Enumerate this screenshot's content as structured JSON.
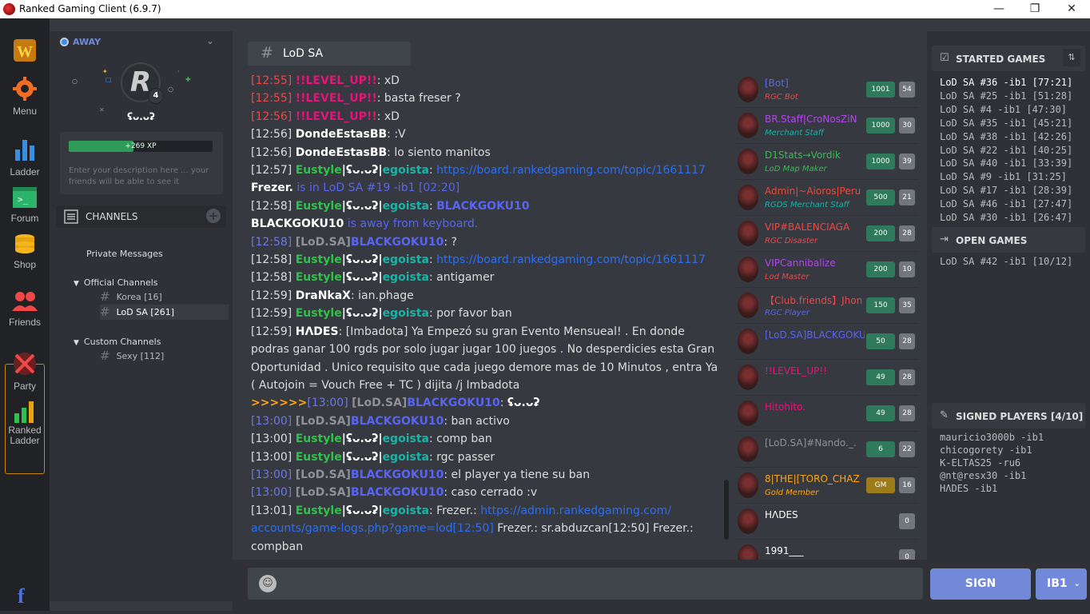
{
  "window": {
    "title": "Ranked Gaming Client (6.9.7)",
    "min": "—",
    "max": "❐",
    "close": "✕"
  },
  "nav": {
    "menu": "Menu",
    "ladder": "Ladder",
    "forum": "Forum",
    "shop": "Shop",
    "friends": "Friends",
    "party": "Party",
    "ranked_ladder_1": "Ranked",
    "ranked_ladder_2": "Ladder"
  },
  "profile": {
    "status": "AWAY",
    "username": "ʢᴗ.ᴗʡ",
    "level": "4",
    "avatar_letter": "R",
    "xp": "+269 XP",
    "xp_progress": 0.45,
    "description": "Enter your description here ... your friends will be able to see it"
  },
  "channels": {
    "header": "CHANNELS",
    "private": "Private Messages",
    "official": "Official Channels",
    "official_list": [
      "Korea [16]",
      "LoD SA [261]"
    ],
    "custom": "Custom Channels",
    "custom_list": [
      "Sexy [112]"
    ]
  },
  "chat": {
    "tab": "LoD SA",
    "hash": "#",
    "messages": [
      {
        "ts": "[12:55]",
        "tsc": "ts-r",
        "name": "!!LEVEL_UP!!",
        "nc": "lvl-r",
        "text": ": xD"
      },
      {
        "ts": "[12:55]",
        "tsc": "ts-r",
        "name": "!!LEVEL_UP!!",
        "nc": "lvl-r",
        "text": ": basta freser ?"
      },
      {
        "ts": "[12:56]",
        "tsc": "ts-r",
        "name": "!!LEVEL_UP!!",
        "nc": "lvl-r",
        "text": ": xD"
      },
      {
        "ts": "[12:56]",
        "name": "DondeEstasBB",
        "nc": "wh",
        "text": ": :V"
      },
      {
        "ts": "[12:56]",
        "name": "DondeEstasBB",
        "nc": "wh",
        "text": ": lo siento manitos"
      },
      {
        "ts": "[12:57]",
        "name": "Eustyle",
        "nc": "grn",
        "sep": "|",
        "name2": "ʢᴗ.ᴗʡ",
        "n2c": "wh",
        "sep2": "|",
        "name3": "egoista",
        "n3c": "teal",
        "text": ": ",
        "link": "https://board.rankedgaming.com/topic/1661117"
      },
      {
        "ts": "",
        "name": "Frezer.",
        "nc": "wh",
        "text2": " is in LoD SA #19 -ib1 [02:20]"
      },
      {
        "ts": "[12:58]",
        "name": "Eustyle",
        "nc": "grn",
        "sep": "|",
        "name2": "ʢᴗ.ᴗʡ",
        "n2c": "wh",
        "sep2": "|",
        "name3": "egoista",
        "n3c": "teal",
        "text": ": ",
        "text3": "BLACKGOKU10"
      },
      {
        "ts": "",
        "name": "BLACKGOKU10",
        "nc": "wh",
        "text2": " is away from keyboard."
      },
      {
        "ts": "[12:58]",
        "tsc": "bl-ts",
        "pre": "[LoD.SA]",
        "name": "BLACKGOKU10",
        "nc": "bk",
        "text": ": ?"
      },
      {
        "ts": "[12:58]",
        "name": "Eustyle",
        "nc": "grn",
        "sep": "|",
        "name2": "ʢᴗ.ᴗʡ",
        "n2c": "wh",
        "sep2": "|",
        "name3": "egoista",
        "n3c": "teal",
        "text": ": ",
        "link": "https://board.rankedgaming.com/topic/1661117"
      },
      {
        "ts": "[12:58]",
        "name": "Eustyle",
        "nc": "grn",
        "sep": "|",
        "name2": "ʢᴗ.ᴗʡ",
        "n2c": "wh",
        "sep2": "|",
        "name3": "egoista",
        "n3c": "teal",
        "text": ": antigamer"
      },
      {
        "ts": "[12:59]",
        "name": "DraNkaX",
        "nc": "wh",
        "text": ": ian.phage"
      },
      {
        "ts": "[12:59]",
        "name": "Eustyle",
        "nc": "grn",
        "sep": "|",
        "name2": "ʢᴗ.ᴗʡ",
        "n2c": "wh",
        "sep2": "|",
        "name3": "egoista",
        "n3c": "teal",
        "text": ": por favor ban"
      },
      {
        "ts": "[12:59]",
        "name": "HΛDES",
        "nc": "wh",
        "text": ": [Imbadota] Ya Empezó su gran Evento Mensueal! . En donde podras ganar 100 rgds por solo jugar jugar 100 juegos . No desperdicies esta Gran Oportunidad . Unico requisito que cada juego demore mas de 10 Minutos , entra Ya ( Autojoin = Vouch Free + TC ) dijita /j Imbadota"
      },
      {
        "ts": "[13:00]",
        "tsc": "bl-ts",
        "arrow": ">>>>>>",
        "pre": "[LoD.SA]",
        "name": "BLACKGOKU10",
        "nc": "bk",
        "text": ": ",
        "text4": "ʢᴗ.ᴗʡ"
      },
      {
        "ts": "[13:00]",
        "tsc": "bl-ts",
        "pre": "[LoD.SA]",
        "name": "BLACKGOKU10",
        "nc": "bk",
        "text": ": ban activo"
      },
      {
        "ts": "[13:00]",
        "name": "Eustyle",
        "nc": "grn",
        "sep": "|",
        "name2": "ʢᴗ.ᴗʡ",
        "n2c": "wh",
        "sep2": "|",
        "name3": "egoista",
        "n3c": "teal",
        "text": ": comp ban"
      },
      {
        "ts": "[13:00]",
        "name": "Eustyle",
        "nc": "grn",
        "sep": "|",
        "name2": "ʢᴗ.ᴗʡ",
        "n2c": "wh",
        "sep2": "|",
        "name3": "egoista",
        "n3c": "teal",
        "text": ": rgc passer"
      },
      {
        "ts": "[13:00]",
        "tsc": "bl-ts",
        "pre": "[LoD.SA]",
        "name": "BLACKGOKU10",
        "nc": "bk",
        "text": ": el player ya tiene su ban"
      },
      {
        "ts": "[13:00]",
        "tsc": "bl-ts",
        "pre": "[LoD.SA]",
        "name": "BLACKGOKU10",
        "nc": "bk",
        "text": ": caso cerrado :v"
      },
      {
        "ts": "[13:01]",
        "name": "Eustyle",
        "nc": "grn",
        "sep": "|",
        "name2": "ʢᴗ.ᴗʡ",
        "n2c": "wh",
        "sep2": "|",
        "name3": "egoista",
        "n3c": "teal",
        "text": ": Frezer.: ",
        "link": "https://admin.rankedgaming.com/ accounts/game-logs.php?game=lod[12:50]",
        "tail": " Frezer.: sr.abduzcan[12:50] Frezer.: compban"
      }
    ]
  },
  "users": [
    {
      "name": "[Bot]",
      "nc": "#5865f2",
      "sub": "RGC Bot",
      "sc": "#f04747",
      "b1": "1001",
      "b2": "54"
    },
    {
      "name": "BR.Staff|CroNosZiN",
      "nc": "#b048e8",
      "sub": "Merchant Staff",
      "sc": "#1ab3a8",
      "b1": "1000",
      "b2": "30"
    },
    {
      "name": "D1Stats→Vordik",
      "nc": "#2ec24a",
      "sub": "LoD Map Maker",
      "sc": "#2ec24a",
      "b1": "1000",
      "b2": "39"
    },
    {
      "name": "Admin|~Aioros|Peru",
      "nc": "#e74c3c",
      "sub": "RGDS Merchant Staff",
      "sc": "#1ab3a8",
      "b1": "500",
      "b2": "21"
    },
    {
      "name": "VIP#BALENCIAGA",
      "nc": "#f04747",
      "sub": "RGC Disaster",
      "sc": "#f04747",
      "b1": "200",
      "b2": "28"
    },
    {
      "name": "VIPCannibalize",
      "nc": "#b048e8",
      "sub": "Lod Master",
      "sc": "#f04747",
      "b1": "200",
      "b2": "10"
    },
    {
      "name": "【Club.friends】Jhon",
      "nc": "#f04747",
      "sub": "RGC Player",
      "sc": "#5865f2",
      "b1": "150",
      "b2": "35"
    },
    {
      "name": "[LoD.SA]BLACKGOKU10",
      "nc": "#5865f2",
      "sub": "",
      "sc": "#fff",
      "b1": "50",
      "b2": "28"
    },
    {
      "name": "!!LEVEL_UP!!",
      "nc": "#e8127a",
      "sub": "",
      "sc": "#fff",
      "b1": "49",
      "b2": "28"
    },
    {
      "name": "Hitohito.",
      "nc": "#e8127a",
      "sub": "",
      "sc": "#fff",
      "b1": "49",
      "b2": "28"
    },
    {
      "name": "[LoD.SA]#Nando._.",
      "nc": "#8e9297",
      "sub": "",
      "sc": "#fff",
      "b1": "6",
      "b2": "22"
    },
    {
      "name": "8|THE|[TORO_CHAZ",
      "nc": "#faa61a",
      "sub": "Gold Member",
      "sc": "#faa61a",
      "b1": "GM",
      "b2": "16"
    },
    {
      "name": "HΛDES",
      "nc": "#fff",
      "sub": "",
      "sc": "#fff",
      "b1": "",
      "b2": "0"
    },
    {
      "name": "1991___",
      "nc": "#fff",
      "sub": "",
      "sc": "#fff",
      "b1": "",
      "b2": "0"
    }
  ],
  "games": {
    "started_title": "STARTED GAMES",
    "started": [
      "LoD SA #36 -ib1 [77:21]",
      "LoD SA #25 -ib1 [51:28]",
      "LoD SA #4 -ib1 [47:30]",
      "LoD SA #35 -ib1 [45:21]",
      "LoD SA #38 -ib1 [42:26]",
      "LoD SA #22 -ib1 [40:25]",
      "LoD SA #40 -ib1 [33:39]",
      "LoD SA #9 -ib1 [31:25]",
      "LoD SA #17 -ib1 [28:39]",
      "LoD SA #46 -ib1 [27:47]",
      "LoD SA #30 -ib1 [26:47]"
    ],
    "open_title": "OPEN GAMES",
    "open": [
      "LoD SA #42 -ib1 [10/12]"
    ],
    "signed_title": "SIGNED PLAYERS [4/10]",
    "signed": [
      "mauricio3000b -ib1",
      "chicogorety -ib1",
      "K-ELTAS25 -ru6",
      "@nt@resx30 -ib1",
      "HΛDES -ib1"
    ]
  },
  "footer": {
    "sign": "SIGN",
    "realm": "IB1"
  }
}
